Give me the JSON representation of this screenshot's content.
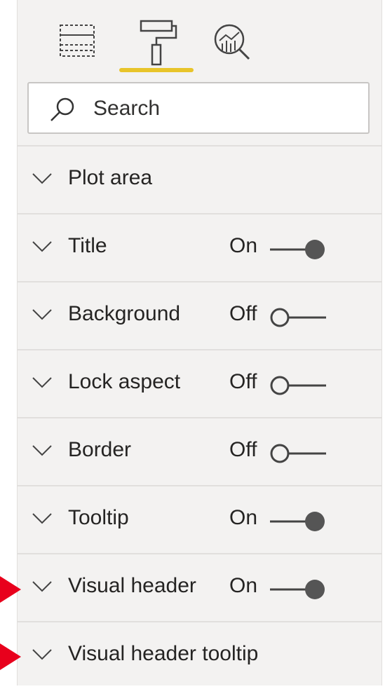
{
  "tabs": [
    {
      "name": "Fields",
      "icon": "fields-icon"
    },
    {
      "name": "Format",
      "icon": "paint-roller-icon",
      "active": true
    },
    {
      "name": "Analytics",
      "icon": "analytics-icon"
    }
  ],
  "accent_color": "#e8c42a",
  "search": {
    "placeholder": "Search"
  },
  "sections": [
    {
      "label": "Plot area",
      "state": ""
    },
    {
      "label": "Title",
      "state": "On"
    },
    {
      "label": "Background",
      "state": "Off"
    },
    {
      "label": "Lock aspect",
      "state": "Off"
    },
    {
      "label": "Border",
      "state": "Off"
    },
    {
      "label": "Tooltip",
      "state": "On"
    },
    {
      "label": "Visual header",
      "state": "On"
    },
    {
      "label": "Visual header tooltip",
      "state": ""
    }
  ],
  "callout_arrow_color": "#e8001c"
}
